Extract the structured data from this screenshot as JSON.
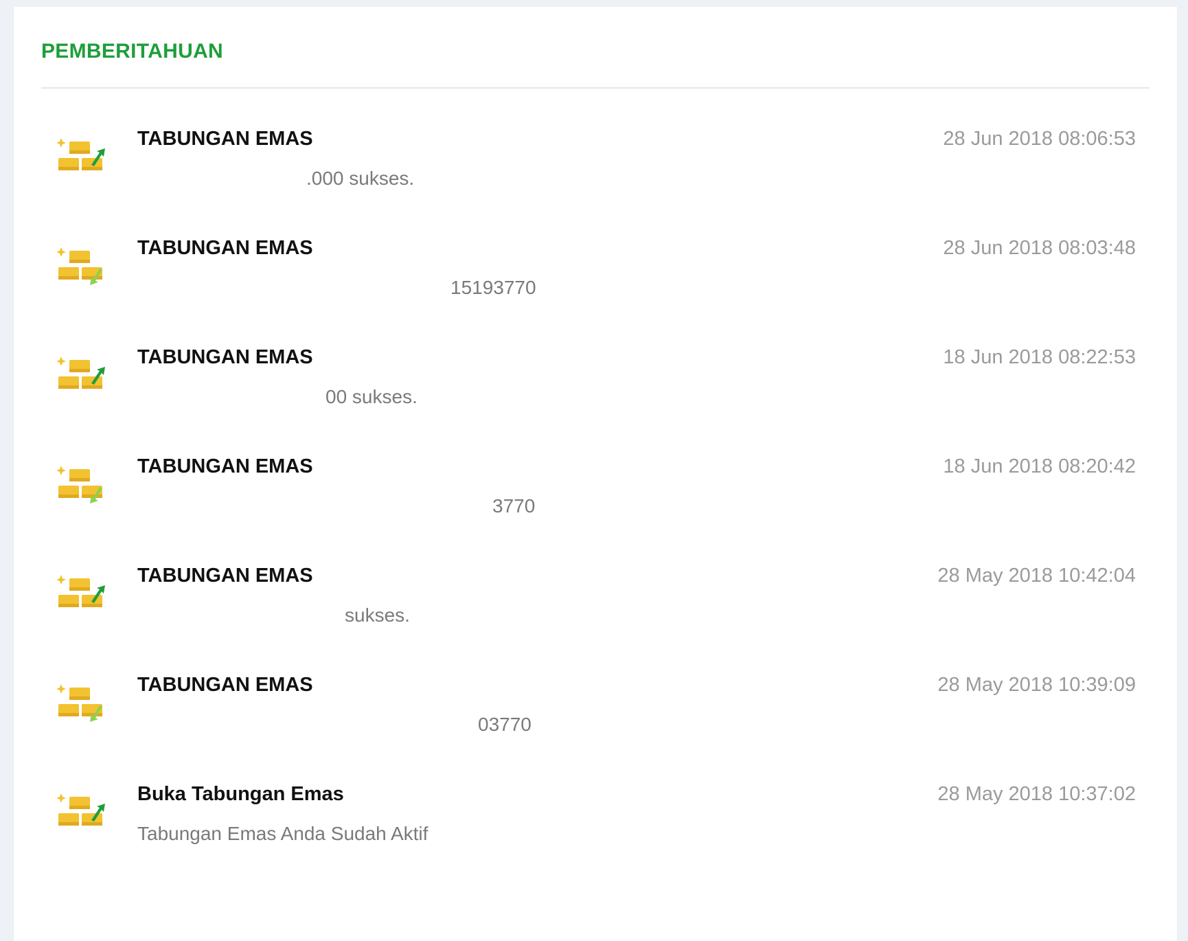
{
  "page": {
    "title": "PEMBERITAHUAN"
  },
  "colors": {
    "accent": "#1e9e3a",
    "gold": "#f2c230",
    "arrow_dark": "#1e9e3a",
    "arrow_light": "#8fd14f"
  },
  "notifications": [
    {
      "title": "TABUNGAN EMAS",
      "time": "28 Jun 2018 08:06:53",
      "message": ".000 sukses.",
      "icon": "gold-bars-up-arrow-icon"
    },
    {
      "title": "TABUNGAN EMAS",
      "time": "28 Jun 2018 08:03:48",
      "message": "15193770",
      "icon": "gold-bars-down-arrow-icon"
    },
    {
      "title": "TABUNGAN EMAS",
      "time": "18 Jun 2018 08:22:53",
      "message": "00 sukses.",
      "icon": "gold-bars-up-arrow-icon"
    },
    {
      "title": "TABUNGAN EMAS",
      "time": "18 Jun 2018 08:20:42",
      "message": "3770",
      "icon": "gold-bars-down-arrow-icon"
    },
    {
      "title": "TABUNGAN EMAS",
      "time": "28 May 2018 10:42:04",
      "message": "sukses.",
      "icon": "gold-bars-up-arrow-icon"
    },
    {
      "title": "TABUNGAN EMAS",
      "time": "28 May 2018 10:39:09",
      "message": "03770",
      "icon": "gold-bars-down-arrow-icon"
    },
    {
      "title": "Buka Tabungan Emas",
      "time": "28 May 2018 10:37:02",
      "message": "Tabungan Emas Anda Sudah Aktif",
      "icon": "gold-bars-up-arrow-icon"
    }
  ]
}
